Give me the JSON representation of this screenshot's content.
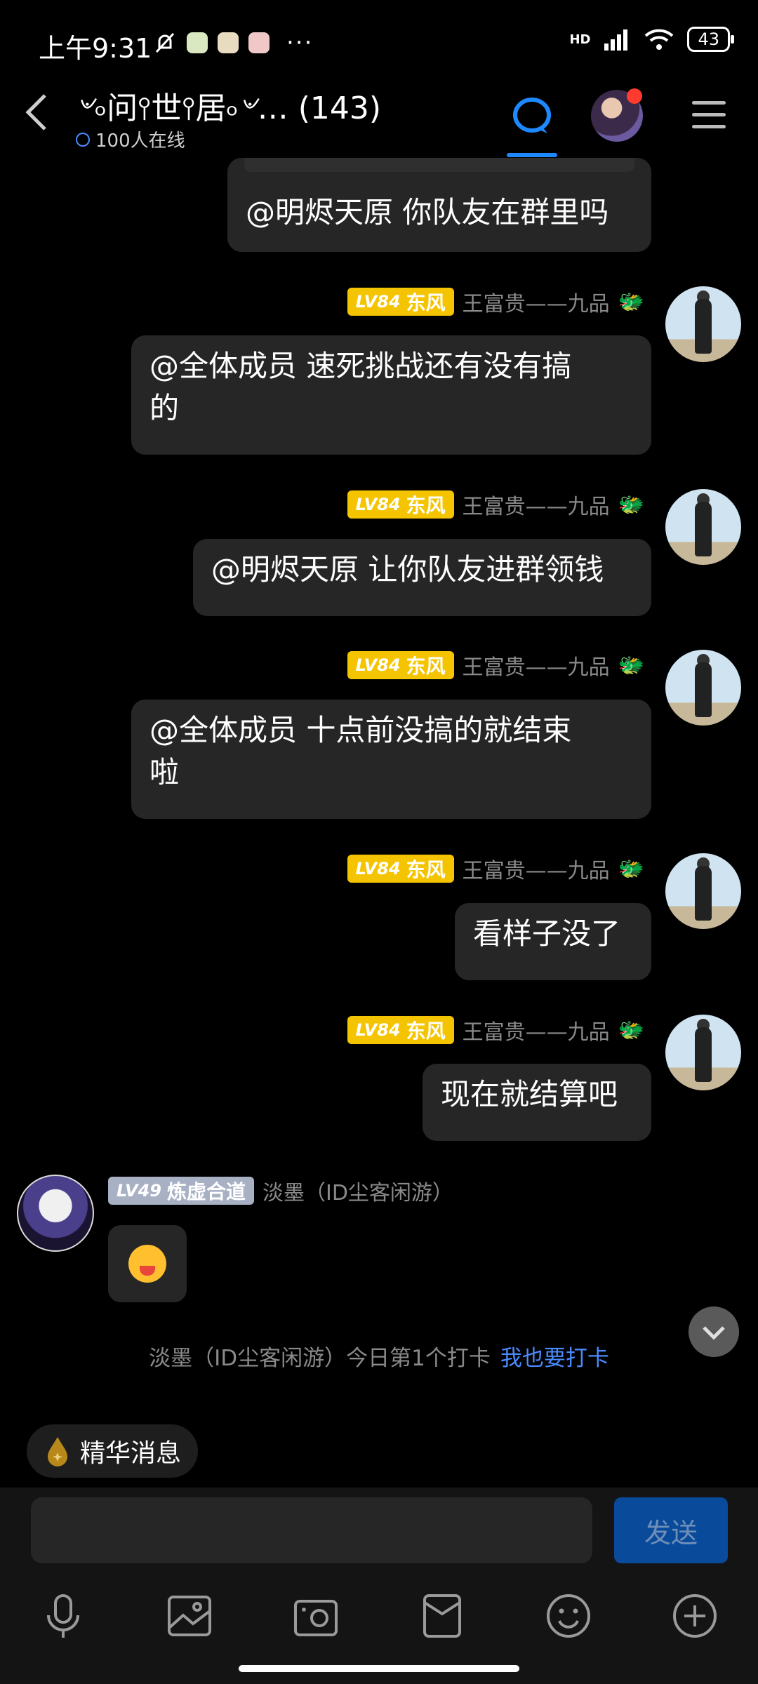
{
  "status_bar": {
    "time": "上午9:31",
    "more": "···",
    "network": "HD",
    "battery": "43"
  },
  "header": {
    "title": "৺৹问⫯世⫯居৹৺… (143)",
    "online": "100人在线"
  },
  "messages": [
    {
      "side": "right",
      "text": "@明烬天原 你队友在群里吗"
    },
    {
      "side": "right",
      "level": "LV84",
      "title": "东风",
      "name": "王富贵——九品",
      "line1": "@全体成员 速死挑战还有没有搞",
      "line2": "的"
    },
    {
      "side": "right",
      "level": "LV84",
      "title": "东风",
      "name": "王富贵——九品",
      "text": "@明烬天原 让你队友进群领钱"
    },
    {
      "side": "right",
      "level": "LV84",
      "title": "东风",
      "name": "王富贵——九品",
      "line1": "@全体成员 十点前没搞的就结束",
      "line2": "啦"
    },
    {
      "side": "right",
      "level": "LV84",
      "title": "东风",
      "name": "王富贵——九品",
      "text": "看样子没了"
    },
    {
      "side": "right",
      "level": "LV84",
      "title": "东风",
      "name": "王富贵——九品",
      "text": "现在就结算吧"
    },
    {
      "side": "left",
      "level": "LV49",
      "title": "炼虚合道",
      "name": "淡墨（ID尘客闲游）"
    }
  ],
  "checkin": {
    "text": "淡墨（ID尘客闲游）今日第1个打卡",
    "link": "我也要打卡"
  },
  "digest": {
    "label": "精华消息"
  },
  "composer": {
    "send_label": "发送"
  },
  "colors": {
    "level_gold": "#f5c400",
    "level_gray": "#a8b0c4",
    "accent": "#1e88ff",
    "bubble": "#262626"
  }
}
